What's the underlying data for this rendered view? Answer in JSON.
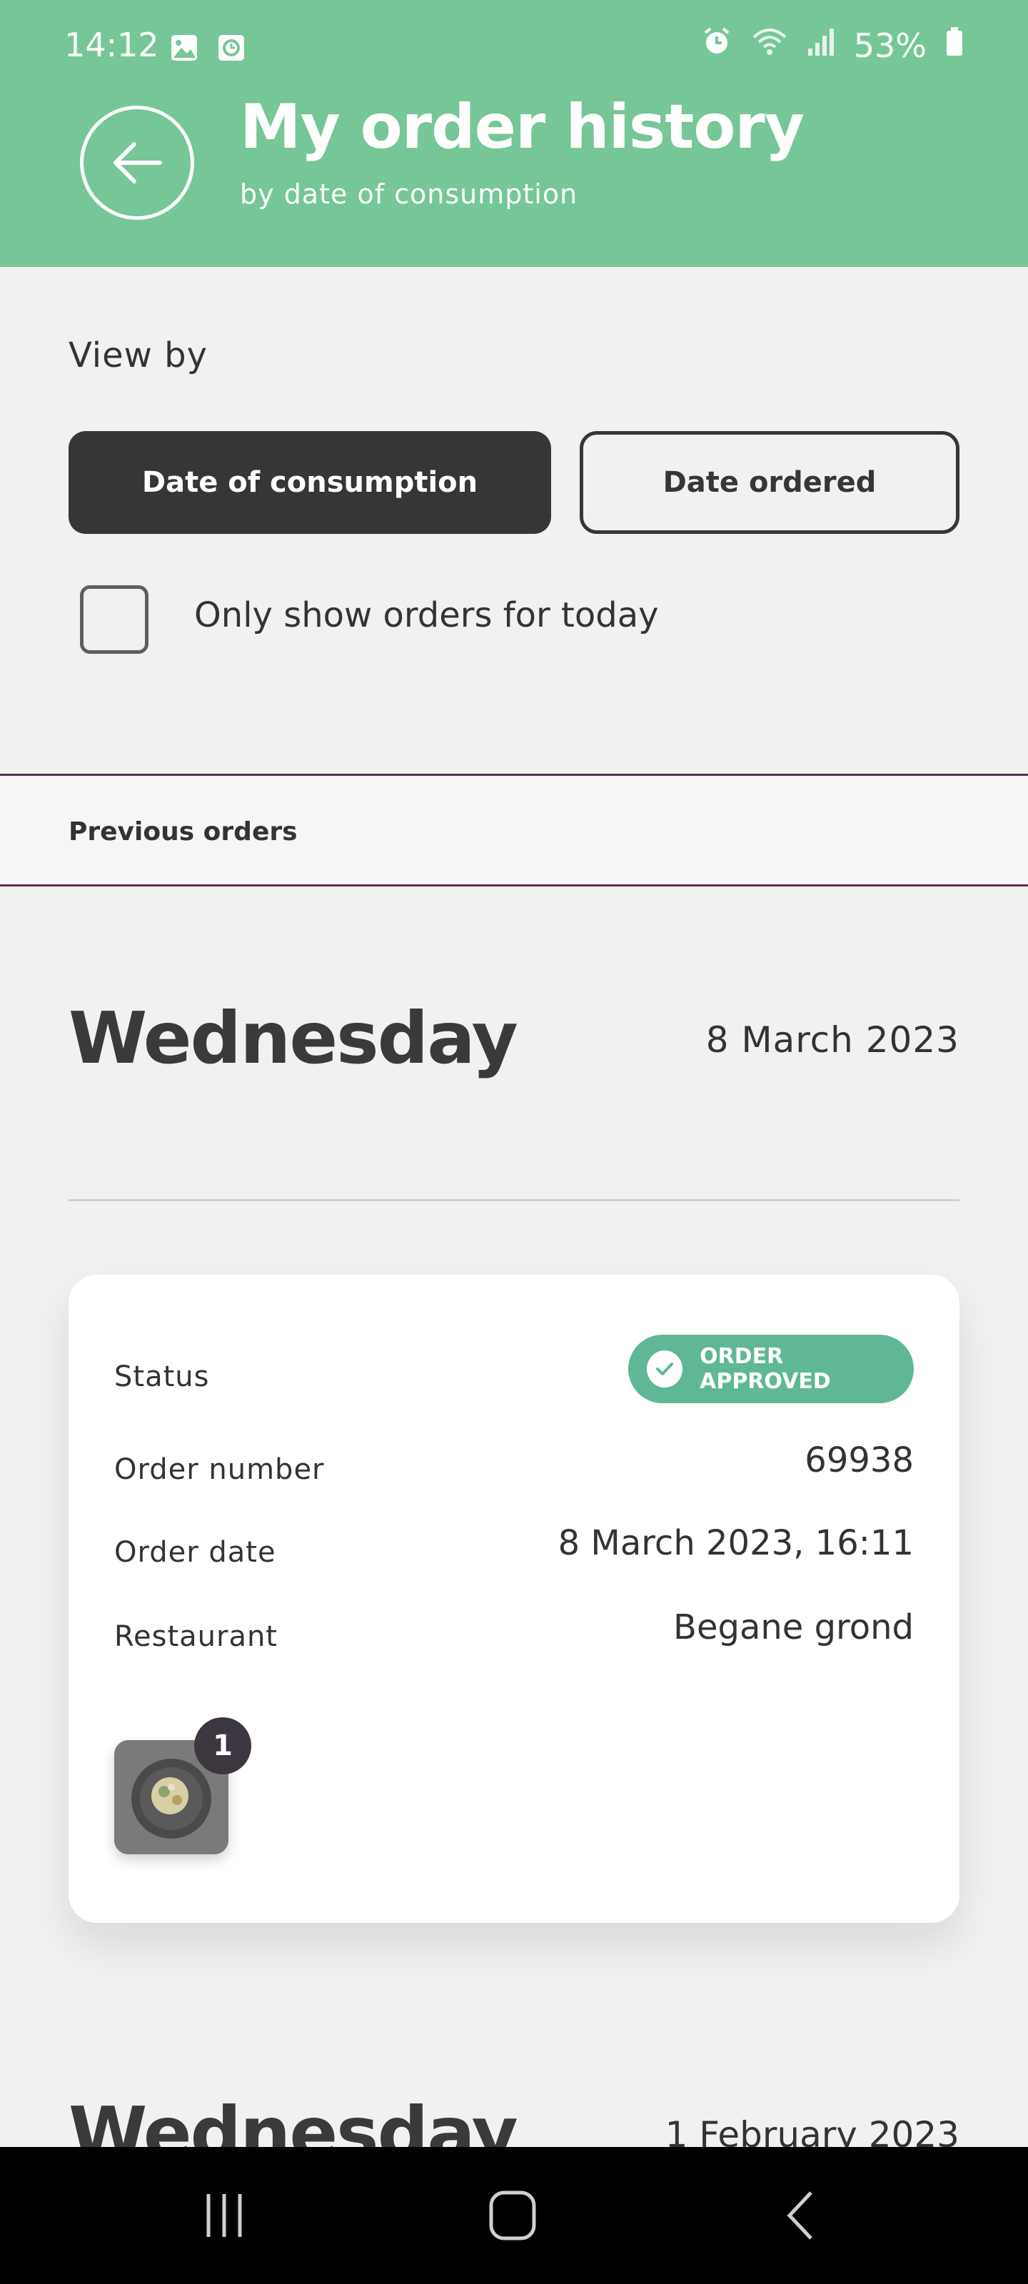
{
  "status_bar": {
    "time": "14:12",
    "battery": "53%"
  },
  "header": {
    "title": "My order history",
    "subtitle": "by date of consumption",
    "accent_color": "#76c698"
  },
  "view_by": {
    "label": "View by",
    "option_active": "Date of consumption",
    "option_inactive": "Date ordered"
  },
  "filter": {
    "today_only_label": "Only show orders for today",
    "checked": false
  },
  "section": {
    "title": "Previous orders"
  },
  "orders": [
    {
      "day_name": "Wednesday",
      "date": "8 March 2023",
      "status_label": "Status",
      "status_value": "ORDER APPROVED",
      "order_number_label": "Order number",
      "order_number": "69938",
      "order_date_label": "Order date",
      "order_date": "8 March 2023, 16:11",
      "restaurant_label": "Restaurant",
      "restaurant": "Begane grond",
      "item_quantity": "1"
    }
  ],
  "next_day": {
    "day_name": "Wednesday",
    "date": "1 February 2023"
  },
  "colors": {
    "approved": "#5fb795",
    "dark_button": "#363636",
    "section_border": "#5a2d55"
  }
}
